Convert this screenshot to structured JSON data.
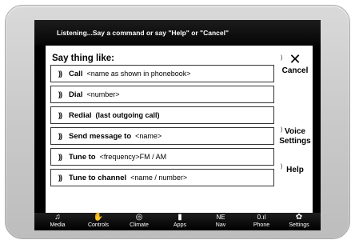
{
  "status": {
    "message": "Listening...Say a command or say \"Help\" or \"Cancel\""
  },
  "prompt": {
    "heading": "Say thing like:",
    "voice_glyph": "))",
    "commands": [
      {
        "verb": "Call",
        "arg": "<name as shown in phonebook>"
      },
      {
        "verb": "Dial",
        "arg": "<number>"
      },
      {
        "verb": "Redial",
        "arg": "(last outgoing call)"
      },
      {
        "verb": "Send message to",
        "arg": "<name>"
      },
      {
        "verb": "Tune to",
        "arg": "<frequency>FM / AM"
      },
      {
        "verb": "Tune to channel",
        "arg": "<name / number>"
      }
    ]
  },
  "side": {
    "cancel_label": "Cancel",
    "voice_settings_line1": "Voice",
    "voice_settings_line2": "Settings",
    "help_label": "Help",
    "wave_glyph": ")"
  },
  "icons": {
    "close": "close-icon",
    "media": "music-note-icon",
    "controls": "hand-icon",
    "climate": "climate-icon",
    "apps": "apps-icon",
    "nav": "compass-icon",
    "phone": "signal-icon",
    "settings": "gear-icon"
  },
  "navbar": {
    "items": [
      {
        "label": "Media",
        "glyph": "♫"
      },
      {
        "label": "Controls",
        "glyph": "✋"
      },
      {
        "label": "Climate",
        "glyph": "◎"
      },
      {
        "label": "Apps",
        "glyph": "▮"
      },
      {
        "label": "Nav",
        "glyph": "NE"
      },
      {
        "label": "Phone",
        "glyph": "0.ıl"
      },
      {
        "label": "Settings",
        "glyph": "✿"
      }
    ]
  }
}
